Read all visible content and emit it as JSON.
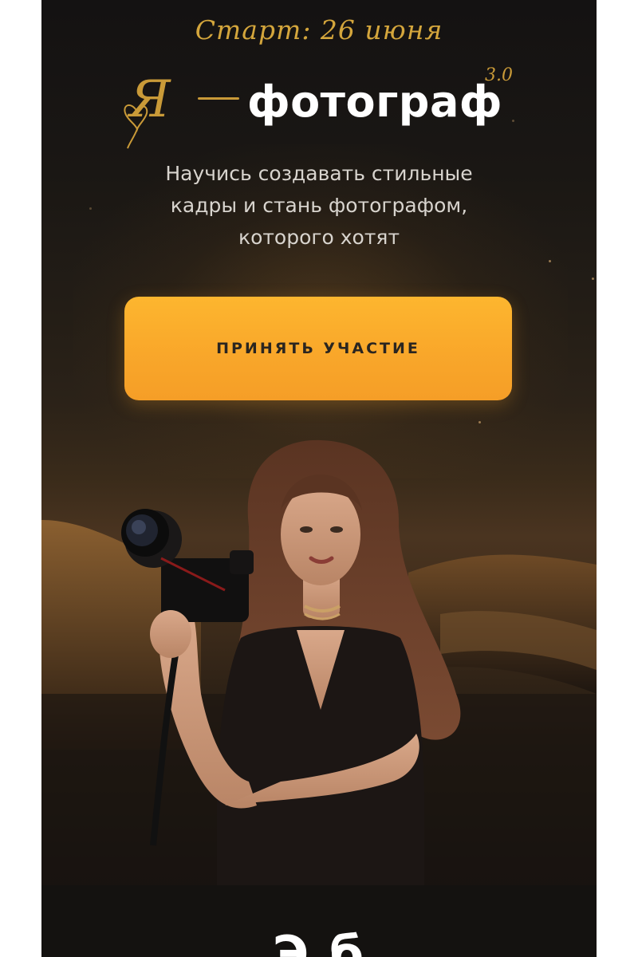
{
  "hero": {
    "start_label": "Старт: 26 июня",
    "logo": {
      "ya": "Я",
      "word": "фотограф",
      "version": "3.0"
    },
    "subtitle_lines": [
      "Научись создавать стильные",
      "кадры и стань фотографом,",
      "которого хотят"
    ],
    "cta_label": "ПРИНЯТЬ УЧАСТИЕ",
    "image_alt": "photographer-with-camera"
  },
  "next_section": {
    "heading_partial": "Э            б"
  },
  "colors": {
    "background": "#1a1714",
    "accent_gold": "#d4a63c",
    "cta_orange": "#fba92b",
    "text_light": "#d8d4ce"
  }
}
